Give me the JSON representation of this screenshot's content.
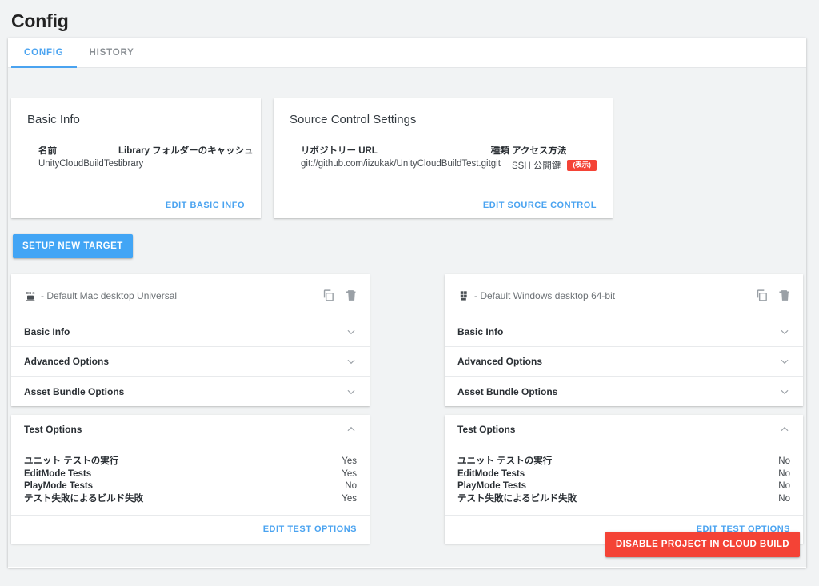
{
  "page_title": "Config",
  "tabs": [
    {
      "label": "CONFIG",
      "active": true
    },
    {
      "label": "HISTORY",
      "active": false
    }
  ],
  "basic_info": {
    "heading": "Basic Info",
    "fields": [
      {
        "label": "名前",
        "value": "UnityCloudBuildTest"
      },
      {
        "label": "Library フォルダーのキャッシュ",
        "value": "library"
      }
    ],
    "action": "EDIT BASIC INFO"
  },
  "source_control": {
    "heading": "Source Control Settings",
    "fields": [
      {
        "label": "リポジトリー URL",
        "value": "git://github.com/iizukak/UnityCloudBuildTest.git"
      },
      {
        "label": "種類",
        "value": "git"
      },
      {
        "label": "アクセス方法",
        "value": "SSH 公開鍵",
        "badge": "(表示)"
      }
    ],
    "action": "EDIT SOURCE CONTROL"
  },
  "setup_new_target_label": "SETUP NEW TARGET",
  "disable_project_label": "DISABLE PROJECT IN CLOUD BUILD",
  "targets": [
    {
      "icon": "osx-icon",
      "title": "- Default Mac desktop Universal",
      "copy_icon": "copy-icon",
      "delete_icon": "trash-icon",
      "sections": [
        {
          "label": "Basic Info",
          "expanded": false
        },
        {
          "label": "Advanced Options",
          "expanded": false
        },
        {
          "label": "Asset Bundle Options",
          "expanded": false
        }
      ],
      "test_options": {
        "label": "Test Options",
        "expanded": true,
        "rows": [
          {
            "name": "ユニット テストの実行",
            "value": "Yes"
          },
          {
            "name": "EditMode Tests",
            "value": "Yes"
          },
          {
            "name": "PlayMode Tests",
            "value": "No"
          },
          {
            "name": "テスト失敗によるビルド失敗",
            "value": "Yes"
          }
        ],
        "action": "EDIT TEST OPTIONS"
      }
    },
    {
      "icon": "windows-icon",
      "title": "- Default Windows desktop 64-bit",
      "copy_icon": "copy-icon",
      "delete_icon": "trash-icon",
      "sections": [
        {
          "label": "Basic Info",
          "expanded": false
        },
        {
          "label": "Advanced Options",
          "expanded": false
        },
        {
          "label": "Asset Bundle Options",
          "expanded": false
        }
      ],
      "test_options": {
        "label": "Test Options",
        "expanded": true,
        "rows": [
          {
            "name": "ユニット テストの実行",
            "value": "No"
          },
          {
            "name": "EditMode Tests",
            "value": "No"
          },
          {
            "name": "PlayMode Tests",
            "value": "No"
          },
          {
            "name": "テスト失敗によるビルド失敗",
            "value": "No"
          }
        ],
        "action": "EDIT TEST OPTIONS"
      }
    }
  ],
  "colors": {
    "accent_blue": "#4aa3f0",
    "button_blue": "#42a5f5",
    "danger_red": "#f44336",
    "page_bg": "#f1f3f4",
    "card_bg": "#ffffff"
  }
}
